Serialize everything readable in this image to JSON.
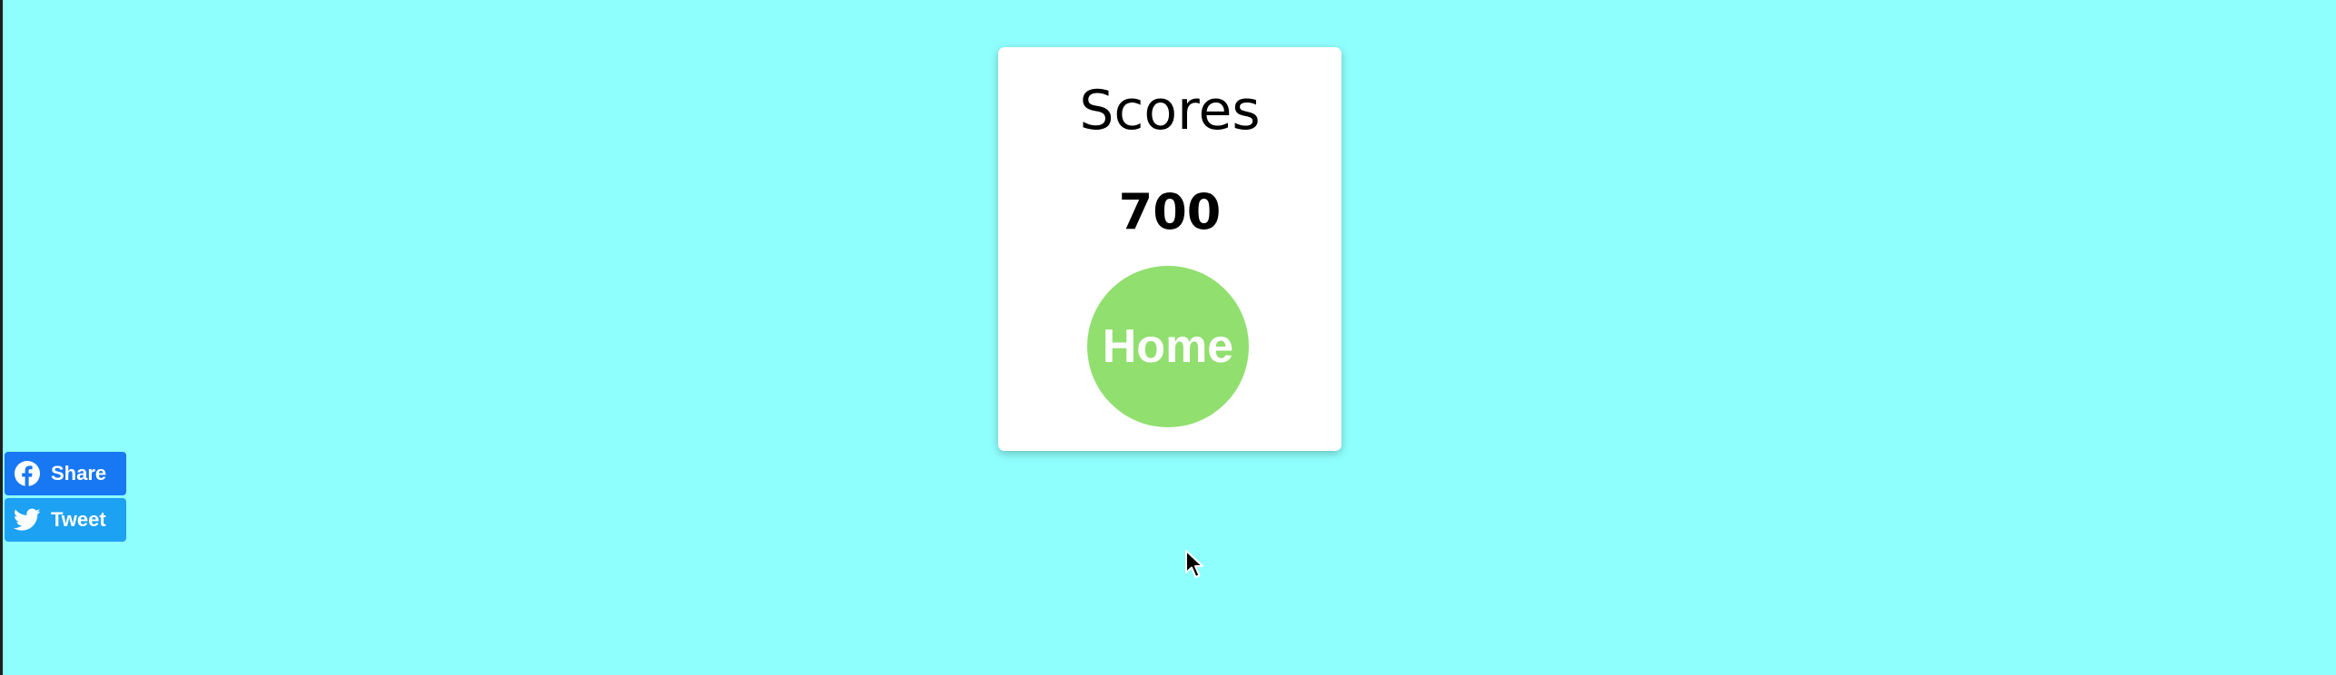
{
  "page": {
    "background_color": "#8ffffe"
  },
  "score_card": {
    "title": "Scores",
    "score": "700",
    "home_button_label": "Home",
    "home_button_color": "#91df6f"
  },
  "social": {
    "facebook": {
      "label": "Share",
      "icon": "facebook-icon",
      "color": "#1877f2"
    },
    "twitter": {
      "label": "Tweet",
      "icon": "twitter-icon",
      "color": "#1da1f2"
    }
  },
  "cursor": {
    "icon": "mouse-pointer-icon"
  }
}
